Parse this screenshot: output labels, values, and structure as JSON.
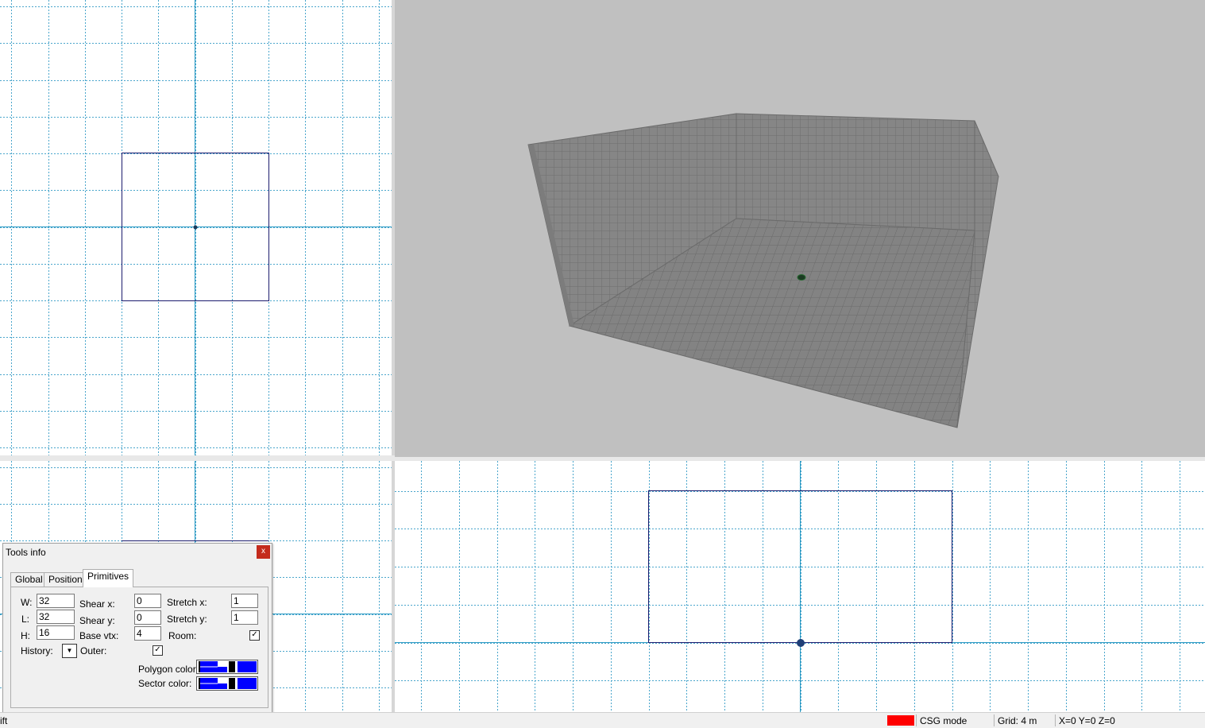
{
  "colors": {
    "grid_major": "#1a8fbf",
    "grid_minor": "#4aa6cc",
    "axis": "#2a9ac4",
    "primitive_outline": "#1c1c6e",
    "viewport3d_bg": "#c0c0c0",
    "viewport3d_wall": "#858585",
    "csg_indicator": "#ff0000",
    "selected_color": "#0000ff"
  },
  "tools_info": {
    "title": "Tools info",
    "close_glyph": "x",
    "tabs": [
      {
        "label": "Global"
      },
      {
        "label": "Position"
      },
      {
        "label": "Primitives"
      }
    ],
    "fields": {
      "w_label": "W:",
      "w_value": "32",
      "l_label": "L:",
      "l_value": "32",
      "h_label": "H:",
      "h_value": "16",
      "shear_x_label": "Shear x:",
      "shear_x_value": "0",
      "shear_y_label": "Shear y:",
      "shear_y_value": "0",
      "base_vtx_label": "Base vtx:",
      "base_vtx_value": "4",
      "stretch_x_label": "Stretch x:",
      "stretch_x_value": "1",
      "stretch_y_label": "Stretch y:",
      "stretch_y_value": "1",
      "room_label": "Room:",
      "room_checked": "✓",
      "history_label": "History:",
      "history_arrow": "▼",
      "outer_label": "Outer:",
      "outer_checked": "✓",
      "polygon_color_label": "Polygon color:",
      "sector_color_label": "Sector color:"
    }
  },
  "status_bar": {
    "left_text": "ift",
    "mode": "CSG mode",
    "grid": "Grid: 4 m",
    "coords": "X=0 Y=0 Z=0"
  },
  "viewports": [
    {
      "name": "top-left-2d"
    },
    {
      "name": "perspective-3d"
    },
    {
      "name": "bottom-left-2d"
    },
    {
      "name": "bottom-right-2d"
    }
  ]
}
